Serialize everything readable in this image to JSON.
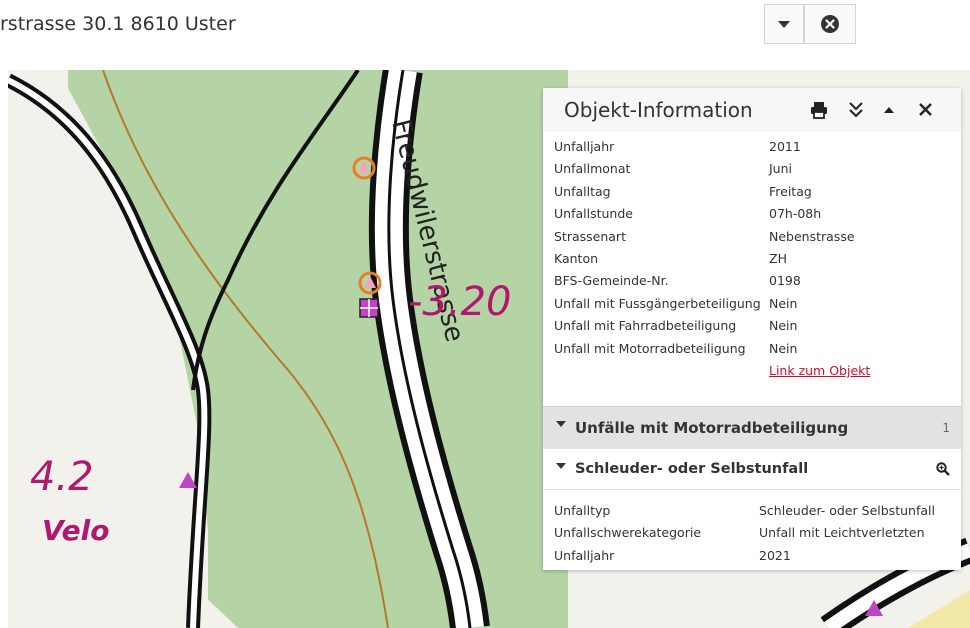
{
  "search": {
    "value": "rstrasse 30.1 8610 Uster",
    "dropdown_icon": "caret-down-icon",
    "clear_icon": "close-circle-icon"
  },
  "map": {
    "street_name": "Freudwilerstrasse",
    "annotations": {
      "right_value": "-3.20",
      "left_value": "4.2",
      "left_note": "Velo"
    },
    "colors": {
      "forest": "#b5d4a6",
      "road_casing": "#111111",
      "path": "#b6782a",
      "annotation": "#b0186e",
      "marker_orange": "#e87d2a",
      "marker_magenta": "#c045c6"
    }
  },
  "panel": {
    "title": "Objekt-Information",
    "icons": [
      "print-icon",
      "collapse-all-icon",
      "caret-up-icon",
      "close-icon"
    ],
    "rows": [
      {
        "key": "Unfalljahr",
        "value": "2011"
      },
      {
        "key": "Unfallmonat",
        "value": "Juni"
      },
      {
        "key": "Unfalltag",
        "value": "Freitag"
      },
      {
        "key": "Unfallstunde",
        "value": "07h-08h"
      },
      {
        "key": "Strassenart",
        "value": "Nebenstrasse"
      },
      {
        "key": "Kanton",
        "value": "ZH"
      },
      {
        "key": "BFS-Gemeinde-Nr.",
        "value": "0198"
      },
      {
        "key": "Unfall mit Fussgängerbeteiligung",
        "value": "Nein"
      },
      {
        "key": "Unfall mit Fahrradbeteiligung",
        "value": "Nein"
      },
      {
        "key": "Unfall mit Motorradbeteiligung",
        "value": "Nein"
      }
    ],
    "link_label": "Link zum Objekt",
    "group": {
      "label": "Unfälle mit Motorradbeteiligung",
      "count": "1"
    },
    "subgroup": {
      "label": "Schleuder- oder Selbstunfall",
      "zoom_icon": "zoom-icon"
    },
    "rows2": [
      {
        "key": "Unfalltyp",
        "value": "Schleuder- oder Selbstunfall"
      },
      {
        "key": "Unfallschwerekategorie",
        "value": "Unfall mit Leichtverletzten"
      },
      {
        "key": "Unfalljahr",
        "value": "2021"
      }
    ]
  }
}
